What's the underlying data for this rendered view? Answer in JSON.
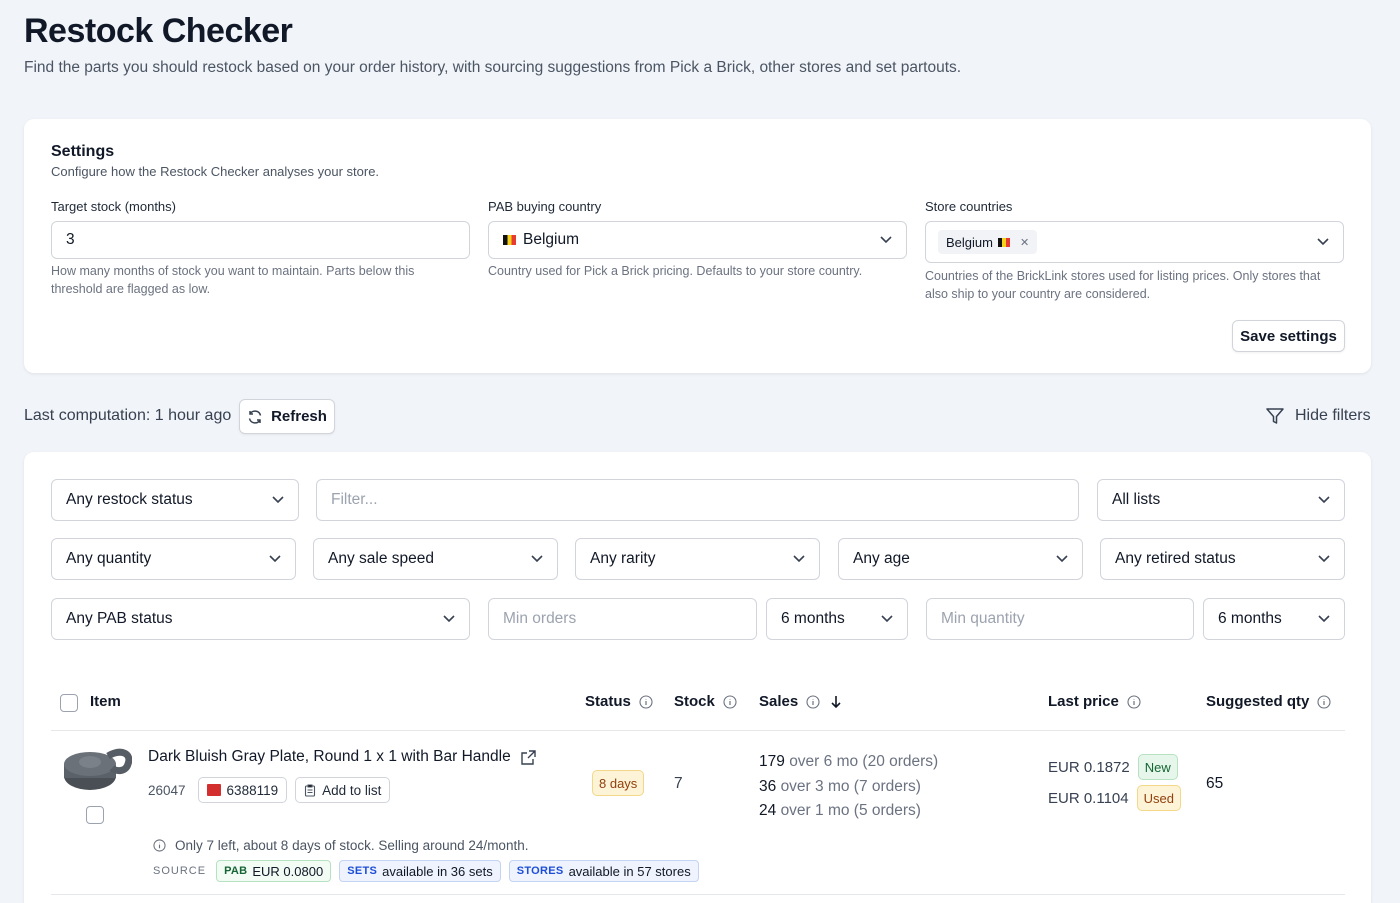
{
  "page": {
    "title": "Restock Checker",
    "subtitle": "Find the parts you should restock based on your order history, with sourcing suggestions from Pick a Brick, other stores and set partouts."
  },
  "settings": {
    "title": "Settings",
    "description": "Configure how the Restock Checker analyses your store.",
    "target_stock": {
      "label": "Target stock (months)",
      "value": "3",
      "help": "How many months of stock you want to maintain. Parts below this threshold are flagged as low."
    },
    "pab_country": {
      "label": "PAB buying country",
      "value": "Belgium",
      "help": "Country used for Pick a Brick pricing. Defaults to your store country."
    },
    "store_countries": {
      "label": "Store countries",
      "chips": [
        "Belgium"
      ],
      "help": "Countries of the BrickLink stores used for listing prices. Only stores that also ship to your country are considered."
    },
    "save_label": "Save settings"
  },
  "toolbar": {
    "last_computation": "Last computation: 1 hour ago",
    "refresh_label": "Refresh",
    "hide_filters_label": "Hide filters"
  },
  "filters": {
    "restock_status": "Any restock status",
    "filter_placeholder": "Filter...",
    "lists": "All lists",
    "quantity": "Any quantity",
    "sale_speed": "Any sale speed",
    "rarity": "Any rarity",
    "age": "Any age",
    "retired": "Any retired status",
    "pab_status": "Any PAB status",
    "min_orders_placeholder": "Min orders",
    "orders_period": "6 months",
    "min_quantity_placeholder": "Min quantity",
    "quantity_period": "6 months"
  },
  "table": {
    "headers": {
      "item": "Item",
      "status": "Status",
      "stock": "Stock",
      "sales": "Sales",
      "last_price": "Last price",
      "suggested_qty": "Suggested qty"
    },
    "rows": [
      {
        "name": "Dark Bluish Gray Plate, Round 1 x 1 with Bar Handle",
        "part_no": "26047",
        "element_id": "6388119",
        "add_to_list": "Add to list",
        "status": "8 days",
        "stock": "7",
        "sales": [
          {
            "qty": "179",
            "period": "over 6 mo (20 orders)"
          },
          {
            "qty": "36",
            "period": "over 3 mo (7 orders)"
          },
          {
            "qty": "24",
            "period": "over 1 mo (5 orders)"
          }
        ],
        "prices": [
          {
            "price": "EUR 0.1872",
            "condition": "New"
          },
          {
            "price": "EUR 0.1104",
            "condition": "Used"
          }
        ],
        "suggested": "65",
        "note": "Only 7 left, about 8 days of stock. Selling around 24/month.",
        "source_label": "SOURCE",
        "sources": {
          "pab": {
            "tag": "PAB",
            "text": "EUR 0.0800"
          },
          "sets": {
            "tag": "SETS",
            "text": "available in 36 sets"
          },
          "stores": {
            "tag": "STORES",
            "text": "available in 57 stores"
          }
        }
      }
    ]
  },
  "colors": {
    "accent_status": "#fdf3d6",
    "new_badge": "#e6f6ea",
    "used_badge": "#fdf3d6",
    "pab": "#e6f6ea",
    "sets_stores": "#e8effc"
  }
}
